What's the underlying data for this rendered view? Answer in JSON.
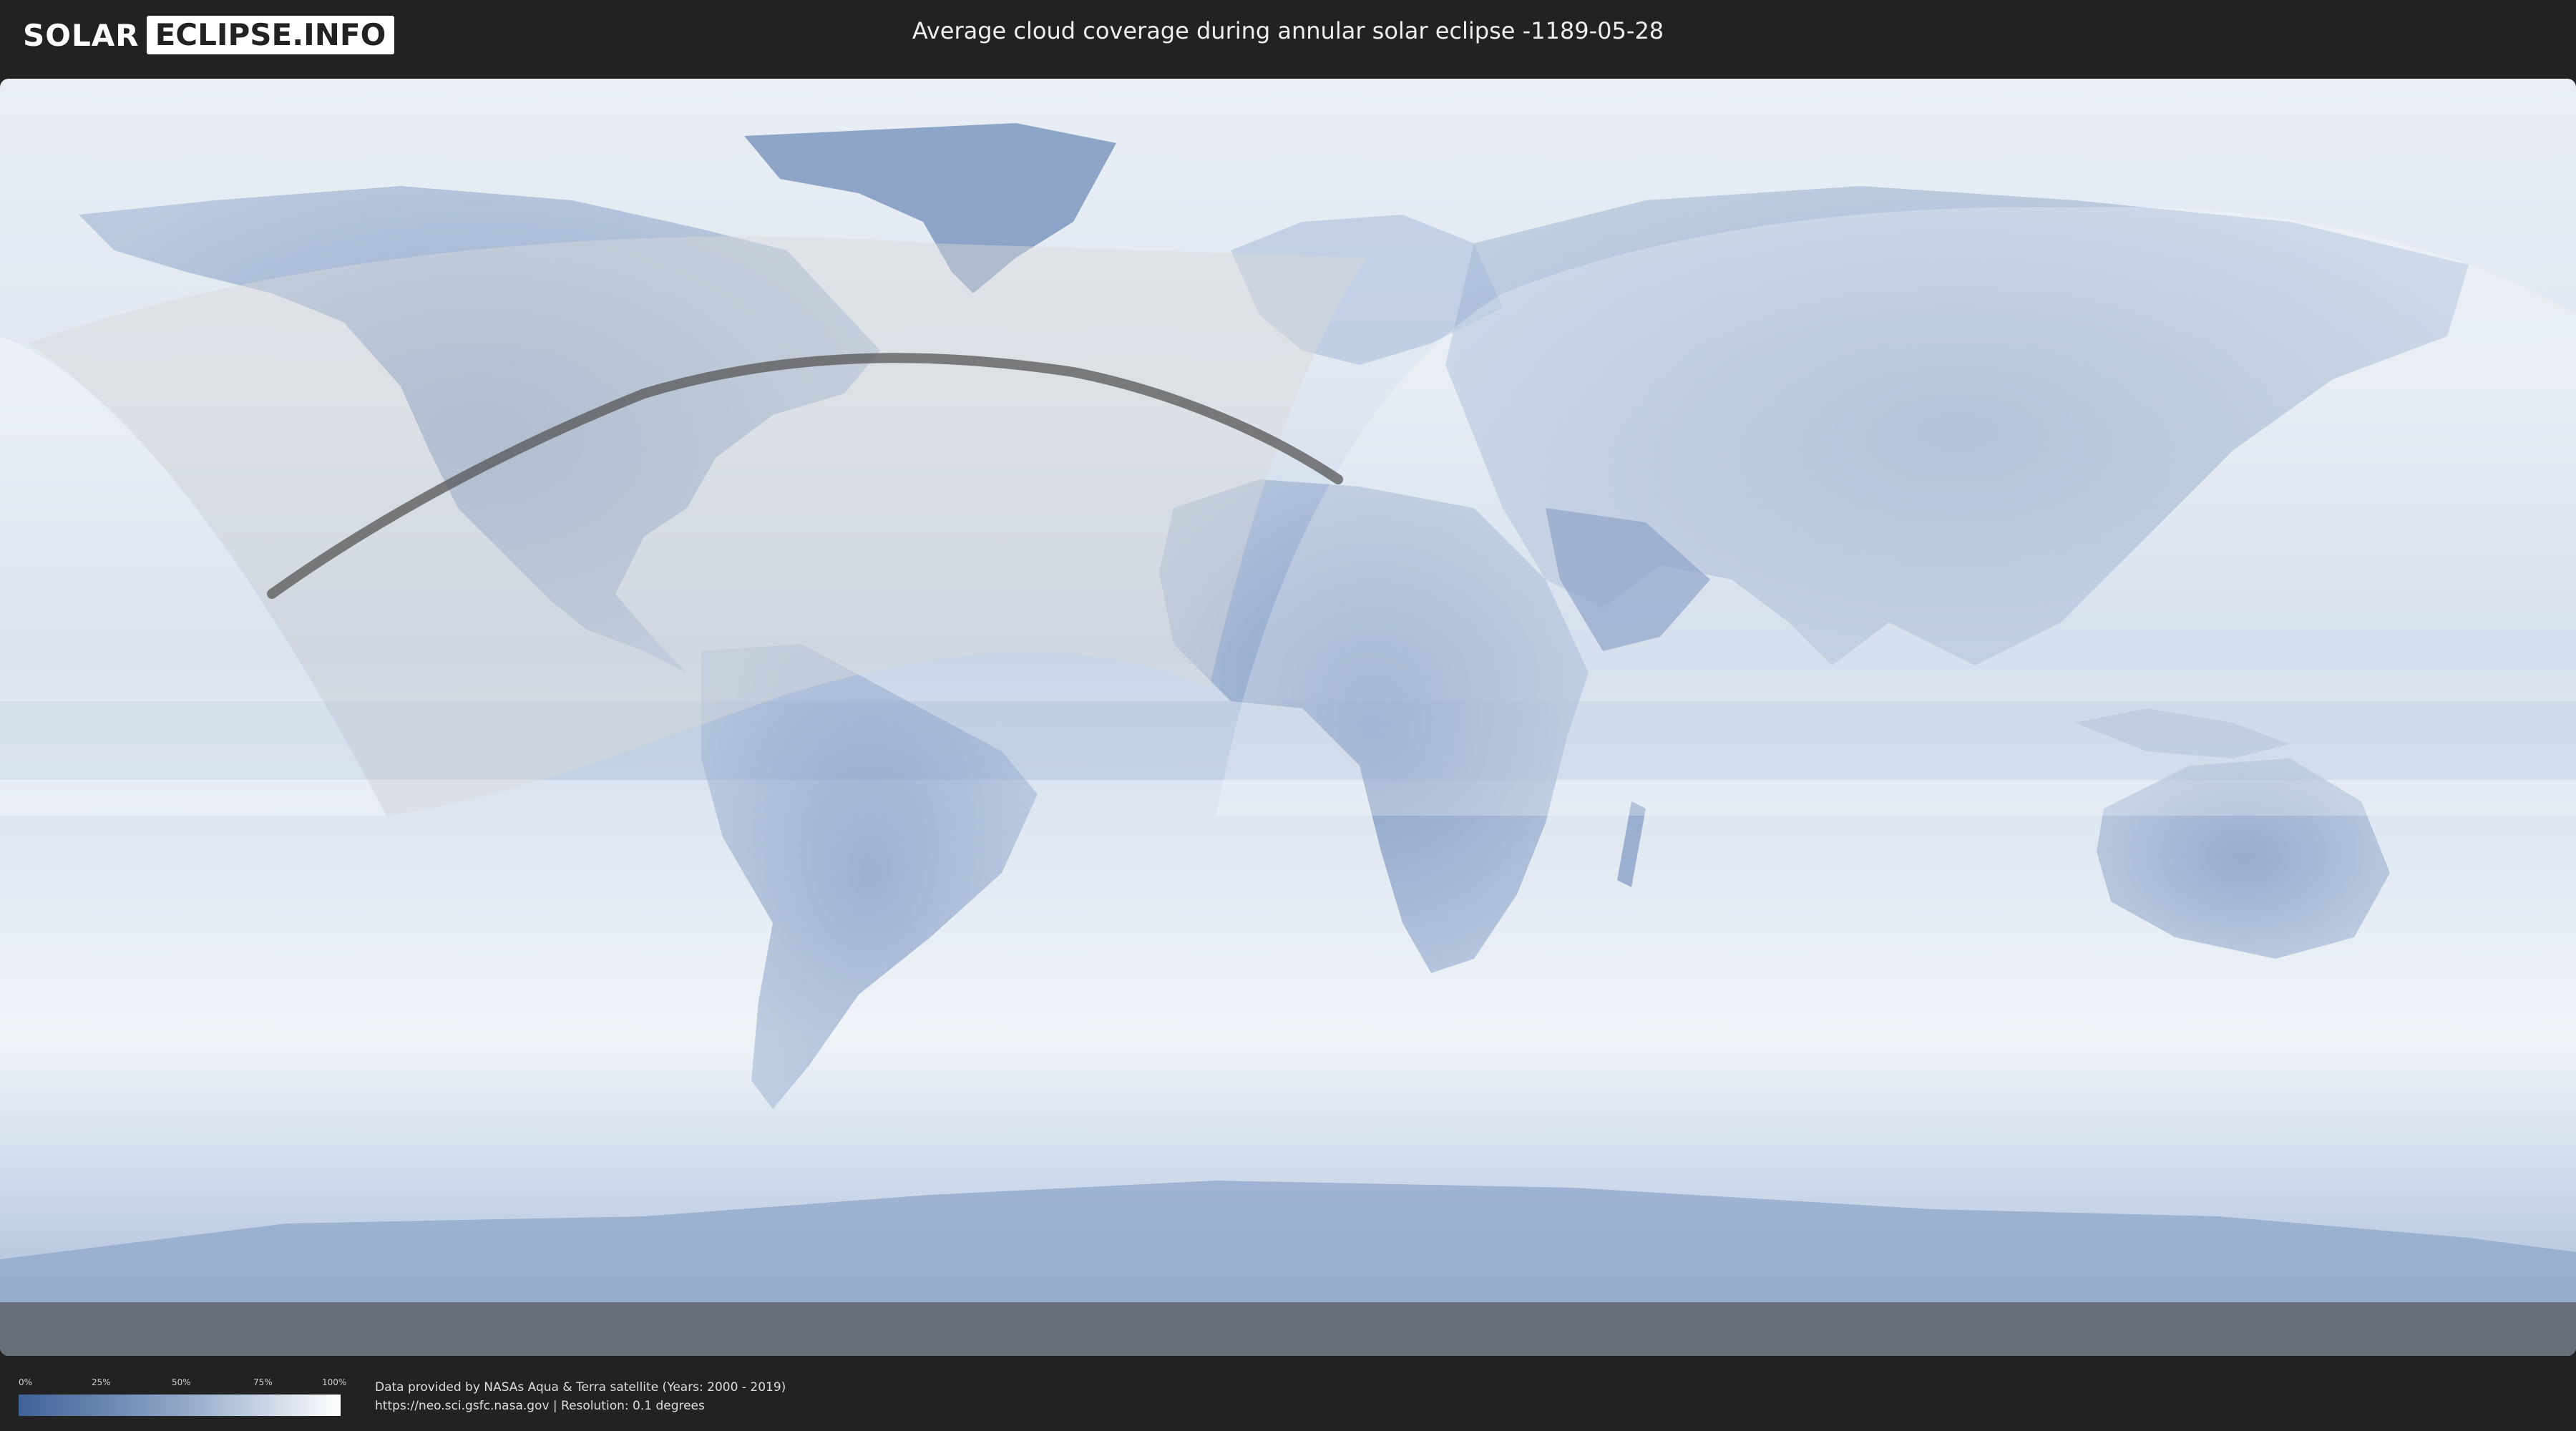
{
  "header": {
    "logo_part1": "SOLAR",
    "logo_part2": "ECLIPSE.INFO",
    "title": "Average cloud coverage during annular solar eclipse -1189-05-28"
  },
  "legend": {
    "ticks": [
      "0%",
      "25%",
      "50%",
      "75%",
      "100%"
    ],
    "colors": {
      "low": "#3f6296",
      "mid": "#8fa6c7",
      "high": "#ffffff"
    }
  },
  "footer": {
    "line1": "Data provided by NASAs Aqua & Terra satellite (Years: 2000 - 2019)",
    "line2": "https://neo.sci.gsfc.nasa.gov | Resolution: 0.1 degrees"
  },
  "map": {
    "eclipse_type": "annular",
    "date": "-1189-05-28",
    "colors": {
      "ocean_cloud": "#dce6f2",
      "land": "#8ea7c9",
      "path": "#555555"
    }
  }
}
